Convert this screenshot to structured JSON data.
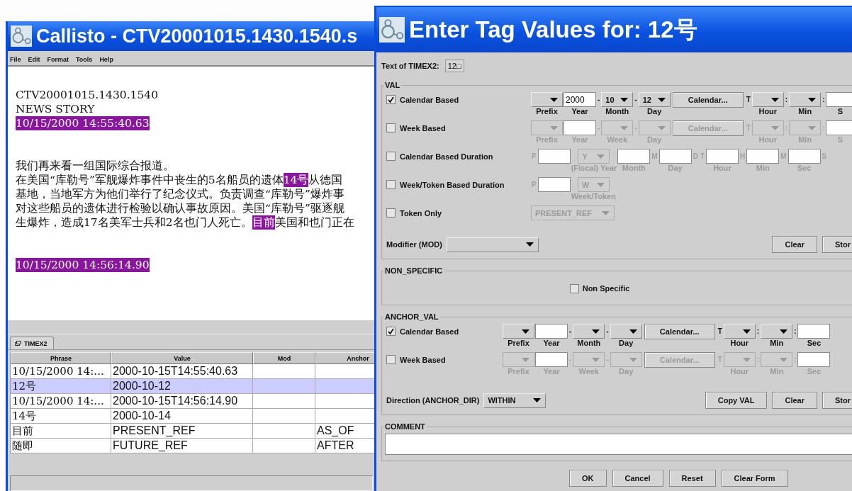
{
  "editor": {
    "title": "Callisto - CTV20001015.1430.1540.s",
    "menu": [
      "File",
      "Edit",
      "Format",
      "Tools",
      "Help"
    ],
    "document": [
      {
        "lines": [
          {
            "segments": [
              {
                "text": "CTV20001015.1430.1540",
                "tagged": false
              }
            ]
          },
          {
            "segments": [
              {
                "text": "NEWS STORY",
                "tagged": false
              }
            ]
          },
          {
            "segments": [
              {
                "text": "10/15/2000 14:55:40.63",
                "tagged": true
              }
            ]
          }
        ]
      },
      {
        "lines": [
          {
            "segments": [
              {
                "text": "我们再来看一组国际综合报道。",
                "tagged": false
              }
            ]
          },
          {
            "segments": [
              {
                "text": "在美国“库勒号”军舰爆炸事件中丧生的5名船员的遗体",
                "tagged": false
              },
              {
                "text": "14号",
                "tagged": true
              },
              {
                "text": "从德国",
                "tagged": false
              }
            ]
          },
          {
            "segments": [
              {
                "text": "基地，当地军方为他们举行了纪念仪式。负责调查“库勒号”爆炸事",
                "tagged": false
              }
            ]
          },
          {
            "segments": [
              {
                "text": "对这些船员的遗体进行检验以确认事故原因。美国“库勒号”驱逐舰",
                "tagged": false
              }
            ]
          },
          {
            "segments": [
              {
                "text": "生爆炸，造成17名美军士兵和2名也门人死亡。",
                "tagged": false
              },
              {
                "text": "目前",
                "tagged": true
              },
              {
                "text": "美国和也门正在",
                "tagged": false
              }
            ]
          }
        ]
      },
      {
        "lines": [
          {
            "segments": [
              {
                "text": "10/15/2000 14:56:14.90",
                "tagged": true
              }
            ]
          }
        ]
      }
    ],
    "tab": {
      "label": "TIMEX2",
      "selected": true
    },
    "table": {
      "columns": [
        "Phrase",
        "Value",
        "Mod",
        "Anchor"
      ],
      "rows": [
        {
          "phrase": "10/15/2000 14:...",
          "value": "2000-10-15T14:55:40.63",
          "selected": false
        },
        {
          "phrase": "12号",
          "value": "2000-10-12",
          "selected": true
        },
        {
          "phrase": "10/15/2000 14:...",
          "value": "2000-10-15T14:56:14.90",
          "selected": false
        },
        {
          "phrase": "14号",
          "value": "2000-10-14",
          "selected": false
        },
        {
          "phrase": "目前",
          "value": "PRESENT_REF",
          "anchor": "AS_OF",
          "selected": false
        },
        {
          "phrase": "随即",
          "value": "FUTURE_REF",
          "anchor": "AFTER",
          "selected": false
        }
      ]
    }
  },
  "dialog": {
    "title": "Enter Tag Values for: 12号",
    "text_label": "Text of TIMEX2:",
    "text_value": "12□",
    "val": {
      "legend": "VAL",
      "rows": [
        {
          "label": "Calendar Based",
          "checked": true,
          "controls": [
            {
              "kind": "combo",
              "label": "Prefix"
            },
            {
              "kind": "input",
              "value": "2000",
              "label": "Year"
            },
            {
              "kind": "sep",
              "text": "-"
            },
            {
              "kind": "combo",
              "value": "10",
              "label": "Month"
            },
            {
              "kind": "sep",
              "text": "-"
            },
            {
              "kind": "combo",
              "value": "12",
              "label": "Day"
            },
            {
              "kind": "button",
              "text": "Calendar..."
            },
            {
              "kind": "sep",
              "text": "T"
            },
            {
              "kind": "combo",
              "label": "Hour"
            },
            {
              "kind": "sep",
              "text": ":"
            },
            {
              "kind": "combo",
              "label": "Min"
            },
            {
              "kind": "sep",
              "text": ":"
            },
            {
              "kind": "input",
              "label": "S"
            }
          ]
        },
        {
          "label": "Week Based",
          "checked": false,
          "controls": [
            {
              "kind": "combo",
              "label": "Prefix"
            },
            {
              "kind": "input",
              "label": "Year"
            },
            {
              "kind": "sep",
              "text": "-"
            },
            {
              "kind": "combo",
              "label": "Week"
            },
            {
              "kind": "sep",
              "text": "-"
            },
            {
              "kind": "combo",
              "label": "Day"
            },
            {
              "kind": "button",
              "text": "Calendar..."
            },
            {
              "kind": "sep",
              "text": "T"
            },
            {
              "kind": "combo",
              "label": "Hour"
            },
            {
              "kind": "sep",
              "text": ":"
            },
            {
              "kind": "combo",
              "label": "Min"
            },
            {
              "kind": "sep",
              "text": ":"
            },
            {
              "kind": "input",
              "label": "S"
            }
          ]
        },
        {
          "label": "Calendar Based Duration",
          "checked": false,
          "controls": [
            {
              "kind": "sep",
              "text": "P"
            },
            {
              "kind": "input"
            },
            {
              "kind": "combo",
              "value": "Y",
              "label": "(Fiscal) Year"
            },
            {
              "kind": "input",
              "label": "Month"
            },
            {
              "kind": "sep",
              "text": "M"
            },
            {
              "kind": "input",
              "label": "Day"
            },
            {
              "kind": "sep",
              "text": "D"
            },
            {
              "kind": "sep",
              "text": "T"
            },
            {
              "kind": "input",
              "label": "Hour"
            },
            {
              "kind": "sep",
              "text": "H"
            },
            {
              "kind": "input",
              "label": "Min"
            },
            {
              "kind": "sep",
              "text": "M"
            },
            {
              "kind": "input",
              "label": "Sec"
            },
            {
              "kind": "sep",
              "text": "S"
            }
          ]
        },
        {
          "label": "Week/Token Based Duration",
          "checked": false,
          "controls": [
            {
              "kind": "sep",
              "text": "P"
            },
            {
              "kind": "input"
            },
            {
              "kind": "combo",
              "value": "W",
              "label": "Week/Token"
            }
          ]
        },
        {
          "label": "Token Only",
          "checked": false,
          "controls": [
            {
              "kind": "combo",
              "value": "PRESENT_REF"
            }
          ]
        }
      ],
      "modifier": {
        "label": "Modifier (MOD)"
      },
      "buttons": [
        "Clear",
        "Stor"
      ]
    },
    "non_specific": {
      "legend": "NON_SPECIFIC",
      "label": "Non Specific",
      "checked": false
    },
    "anchor_val": {
      "legend": "ANCHOR_VAL",
      "rows": [
        {
          "label": "Calendar Based",
          "checked": true,
          "controls": [
            {
              "kind": "combo",
              "label": "Prefix"
            },
            {
              "kind": "input",
              "label": "Year"
            },
            {
              "kind": "sep",
              "text": "-"
            },
            {
              "kind": "combo",
              "label": "Month"
            },
            {
              "kind": "sep",
              "text": "-"
            },
            {
              "kind": "combo",
              "label": "Day"
            },
            {
              "kind": "button",
              "text": "Calendar..."
            },
            {
              "kind": "sep",
              "text": "T"
            },
            {
              "kind": "combo",
              "label": "Hour"
            },
            {
              "kind": "sep",
              "text": ":"
            },
            {
              "kind": "combo",
              "label": "Min"
            },
            {
              "kind": "sep",
              "text": ":"
            },
            {
              "kind": "input",
              "label": "Sec"
            }
          ]
        },
        {
          "label": "Week Based",
          "checked": false,
          "controls": [
            {
              "kind": "combo",
              "label": "Prefix"
            },
            {
              "kind": "input",
              "label": "Year"
            },
            {
              "kind": "sep",
              "text": "-"
            },
            {
              "kind": "combo",
              "label": "Week"
            },
            {
              "kind": "sep",
              "text": "-"
            },
            {
              "kind": "combo",
              "label": "Day"
            },
            {
              "kind": "button",
              "text": "Calendar..."
            },
            {
              "kind": "sep",
              "text": "T"
            },
            {
              "kind": "combo",
              "label": "Hour"
            },
            {
              "kind": "sep",
              "text": ":"
            },
            {
              "kind": "combo",
              "label": "Min"
            },
            {
              "kind": "sep",
              "text": ":"
            },
            {
              "kind": "input",
              "label": "Sec"
            }
          ]
        }
      ],
      "direction": {
        "label": "Direction (ANCHOR_DIR)",
        "value": "WITHIN"
      },
      "buttons": [
        "Copy VAL",
        "Clear",
        "Stor"
      ]
    },
    "comment": {
      "legend": "COMMENT"
    },
    "footer": [
      "OK",
      "Cancel",
      "Reset",
      "Clear Form"
    ]
  }
}
